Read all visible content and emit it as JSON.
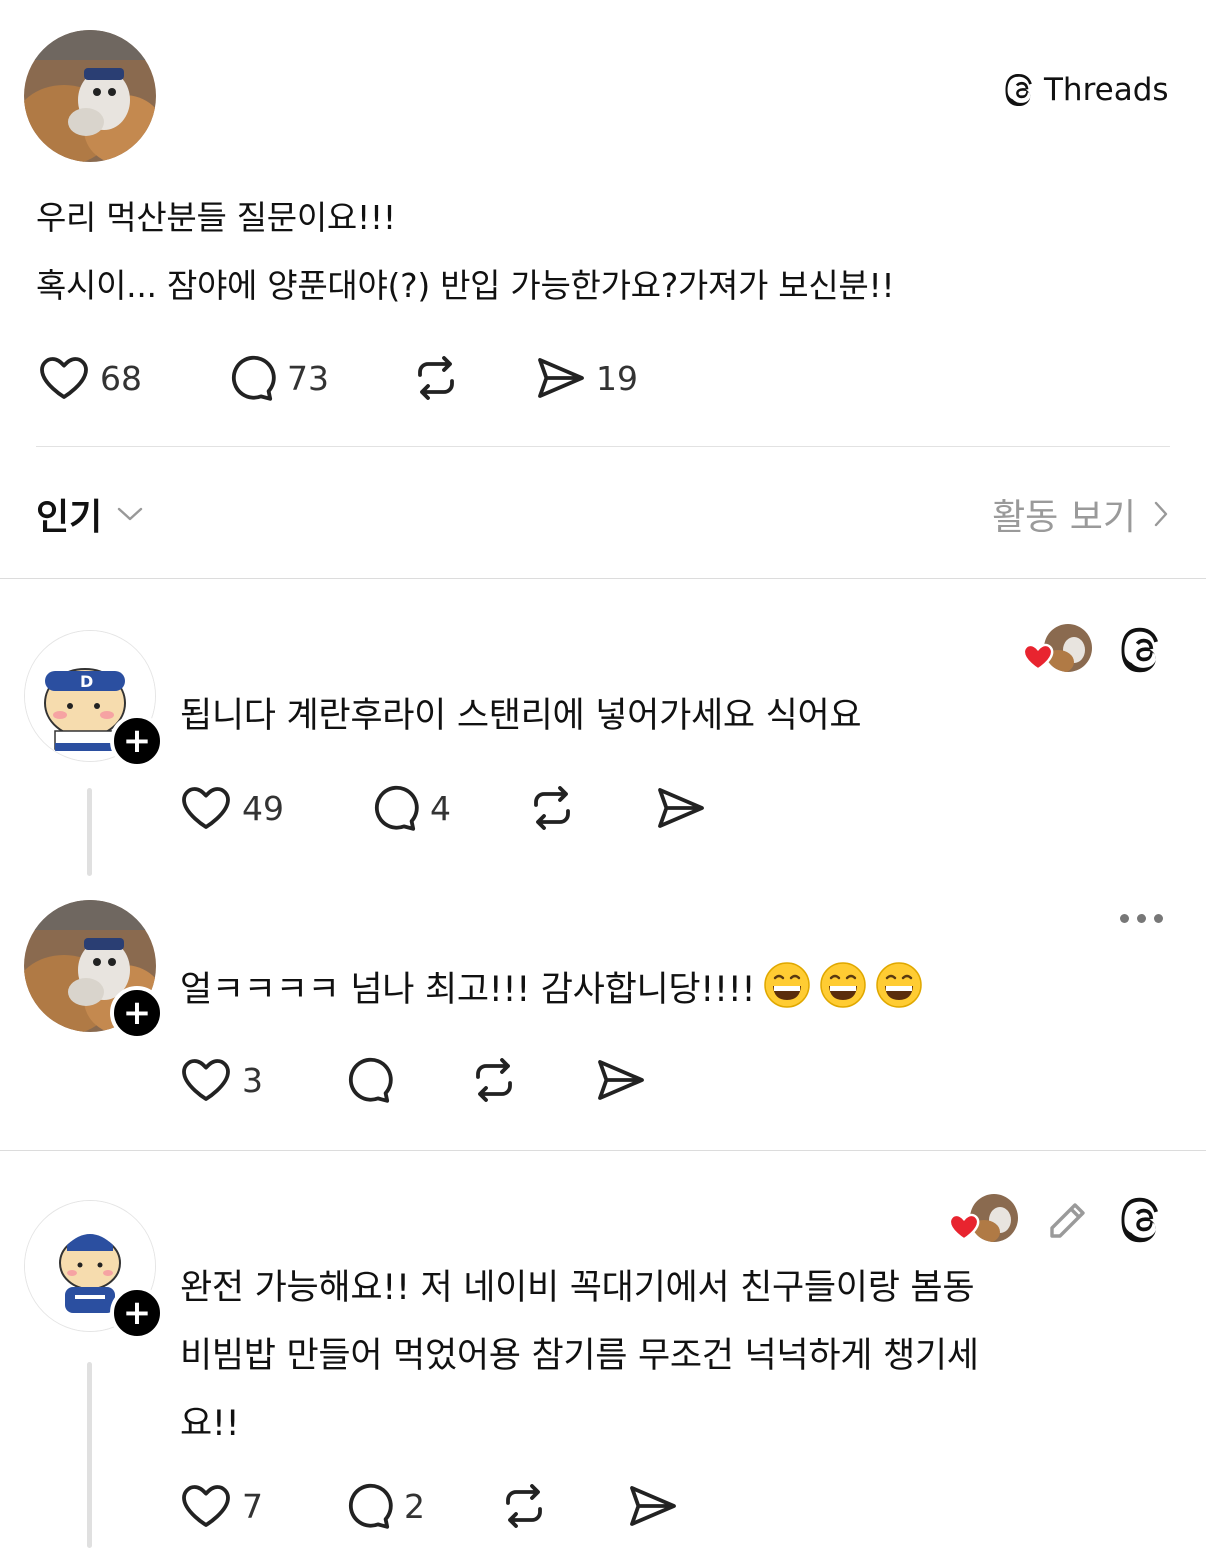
{
  "brand": {
    "name": "Threads"
  },
  "post": {
    "lines": [
      "우리 먹산분들 질문이요!!!",
      "혹시이... 잠야에 양푼대야(?) 반입 가능한가요?가져가 보신분!!"
    ],
    "like_count": "68",
    "reply_count": "73",
    "share_count": "19"
  },
  "sort": {
    "label": "인기"
  },
  "activity": {
    "label": "활동 보기"
  },
  "replies": [
    {
      "text": "됩니다 계란후라이 스탠리에 넣어가세요 식어요",
      "like_count": "49",
      "reply_count": "4"
    },
    {
      "text": "얼ㅋㅋㅋㅋ 넘나 최고!!! 감사합니당!!!!",
      "emoji": [
        "grinning-face",
        "grinning-face",
        "grinning-face"
      ],
      "like_count": "3",
      "reply_count": ""
    },
    {
      "lines": [
        "완전 가능해요!! 저 네이비 꼭대기에서 친구들이랑 봄동",
        "비빔밥 만들어 먹었어용 참기름 무조건 넉넉하게 챙기세",
        "요!!"
      ],
      "like_count": "7",
      "reply_count": "2"
    }
  ],
  "colors": {
    "heart": "#e8242f",
    "icon": "#222222",
    "muted": "#9a9a9a"
  },
  "icons": [
    "threads-logo-icon",
    "heart-icon",
    "comment-icon",
    "repost-icon",
    "share-icon",
    "chevron-down-icon",
    "chevron-right-icon",
    "more-icon",
    "edit-icon",
    "plus-icon"
  ]
}
